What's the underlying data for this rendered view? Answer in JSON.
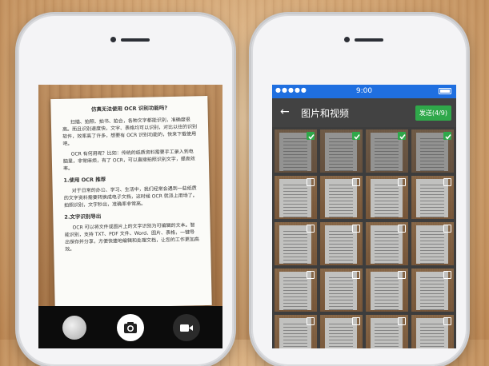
{
  "left_phone": {
    "document": {
      "title": "仿真无法使用 OCR 识别功能吗?",
      "paragraphs": [
        "扫描、拍照、拍书、拍合，各种文字都能识别，准确度很高。而且识别速度快，文字、表格均可以识别，对比以往的识别软件，效率高了许多，想要有 OCR 识别功能的，快来下载使用吧。",
        "OCR 有何用呢？比如：传统的纸质资料需要手工录入到电脑里，非常麻烦，有了 OCR，可以直接拍照识别文字，提高效率。"
      ],
      "section1_title": "1.使用 OCR 推荐",
      "section1_text": "对于日常的办公、学习、生活中，我们经常会遇到一些纸质的文字资料需要转换成电子文档，这时候 OCR 就派上用场了。拍照识别，文字秒出，准确率非常高。",
      "section2_title": "2.文字识别导出",
      "section2_text": "OCR 可以将文件或图片上的文字识别为可编辑的文本。智能识别，支持 TXT、PDF 文件、Word、图片、表格，一键导出保存并分享，方便快捷地编辑和处理文档，让您的工作更加高效。"
    },
    "controls": {
      "gallery": "gallery-thumbnail",
      "shutter": "camera-icon",
      "video": "video-camera-icon"
    }
  },
  "right_phone": {
    "status": {
      "signal": "●●●●● ",
      "time": "9:00"
    },
    "app_bar": {
      "back": "←",
      "title": "图片和视频",
      "send_label": "发送(4/9)"
    },
    "grid": {
      "columns": 4,
      "selected": [
        true,
        true,
        true,
        true,
        false,
        false,
        false,
        false,
        false,
        false,
        false,
        false,
        false,
        false,
        false,
        false,
        false,
        false,
        false,
        false
      ]
    },
    "colors": {
      "status_bar": "#1f6fe0",
      "app_bar": "#424242",
      "accent_green": "#2fa84a"
    }
  }
}
